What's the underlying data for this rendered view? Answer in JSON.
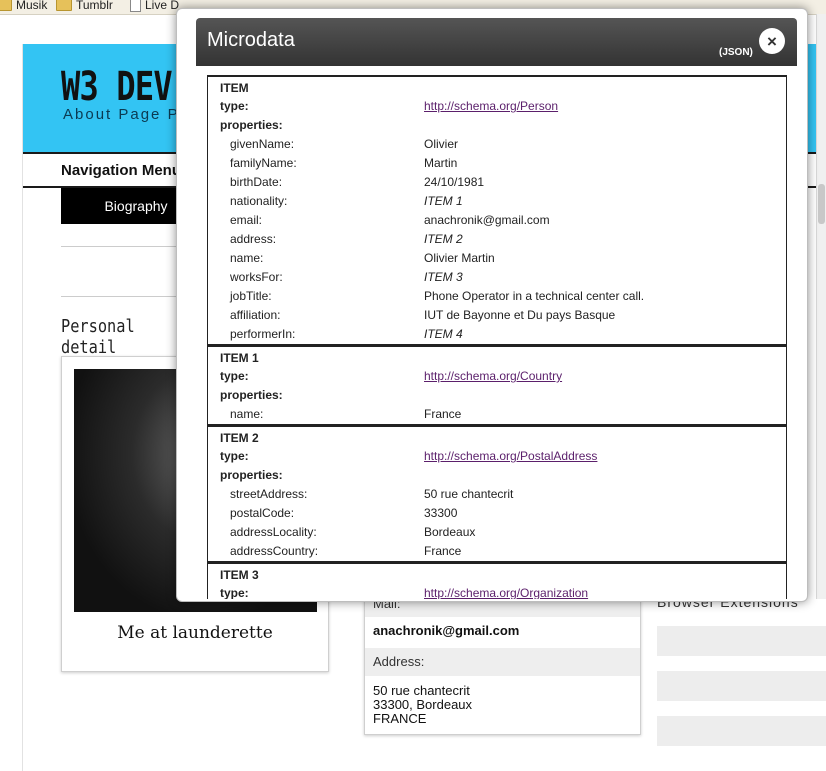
{
  "bookmarks": [
    "Musik",
    "Tumblr",
    "Live D"
  ],
  "site": {
    "title": "W3 DEV",
    "subtitle": "About Page Pr",
    "nav_heading": "Navigation Menu",
    "nav_item": "Biography",
    "section_title": "Personal detail",
    "photo_caption": "Me at launderette"
  },
  "contact": {
    "mail_label": "Mail:",
    "mail_value": "anachronik@gmail.com",
    "address_label": "Address:",
    "address_lines": [
      "50 rue chantecrit",
      "33300, Bordeaux",
      "FRANCE"
    ]
  },
  "extensions_title": "Browser Extensions",
  "modal": {
    "title": "Microdata",
    "json_label": "(JSON)",
    "close_label": "×",
    "items": [
      {
        "heading": "ITEM",
        "type_label": "type:",
        "type_value": "http://schema.org/Person",
        "properties_label": "properties:",
        "properties": [
          {
            "k": "givenName:",
            "v": "Olivier",
            "ref": false
          },
          {
            "k": "familyName:",
            "v": "Martin",
            "ref": false
          },
          {
            "k": "birthDate:",
            "v": "24/10/1981",
            "ref": false
          },
          {
            "k": "nationality:",
            "v": "ITEM 1",
            "ref": true
          },
          {
            "k": "email:",
            "v": "anachronik@gmail.com",
            "ref": false
          },
          {
            "k": "address:",
            "v": "ITEM 2",
            "ref": true
          },
          {
            "k": "name:",
            "v": "Olivier Martin",
            "ref": false
          },
          {
            "k": "worksFor:",
            "v": "ITEM 3",
            "ref": true
          },
          {
            "k": "jobTitle:",
            "v": "Phone Operator in a technical center call.",
            "ref": false
          },
          {
            "k": "affiliation:",
            "v": "IUT de Bayonne et Du pays Basque",
            "ref": false
          },
          {
            "k": "performerIn:",
            "v": "ITEM 4",
            "ref": true
          }
        ]
      },
      {
        "heading": "ITEM 1",
        "type_label": "type:",
        "type_value": "http://schema.org/Country",
        "properties_label": "properties:",
        "properties": [
          {
            "k": "name:",
            "v": "France",
            "ref": false
          }
        ]
      },
      {
        "heading": "ITEM 2",
        "type_label": "type:",
        "type_value": "http://schema.org/PostalAddress",
        "properties_label": "properties:",
        "properties": [
          {
            "k": "streetAddress:",
            "v": "50 rue chantecrit",
            "ref": false
          },
          {
            "k": "postalCode:",
            "v": "33300",
            "ref": false
          },
          {
            "k": "addressLocality:",
            "v": "Bordeaux",
            "ref": false
          },
          {
            "k": "addressCountry:",
            "v": "France",
            "ref": false
          }
        ]
      },
      {
        "heading": "ITEM 3",
        "type_label": "type:",
        "type_value": "http://schema.org/Organization",
        "properties_label": "",
        "properties": []
      }
    ]
  },
  "colors": {
    "header_band": "#33c4f3",
    "link": "#5b1f6b",
    "modal_header": "#444444"
  }
}
